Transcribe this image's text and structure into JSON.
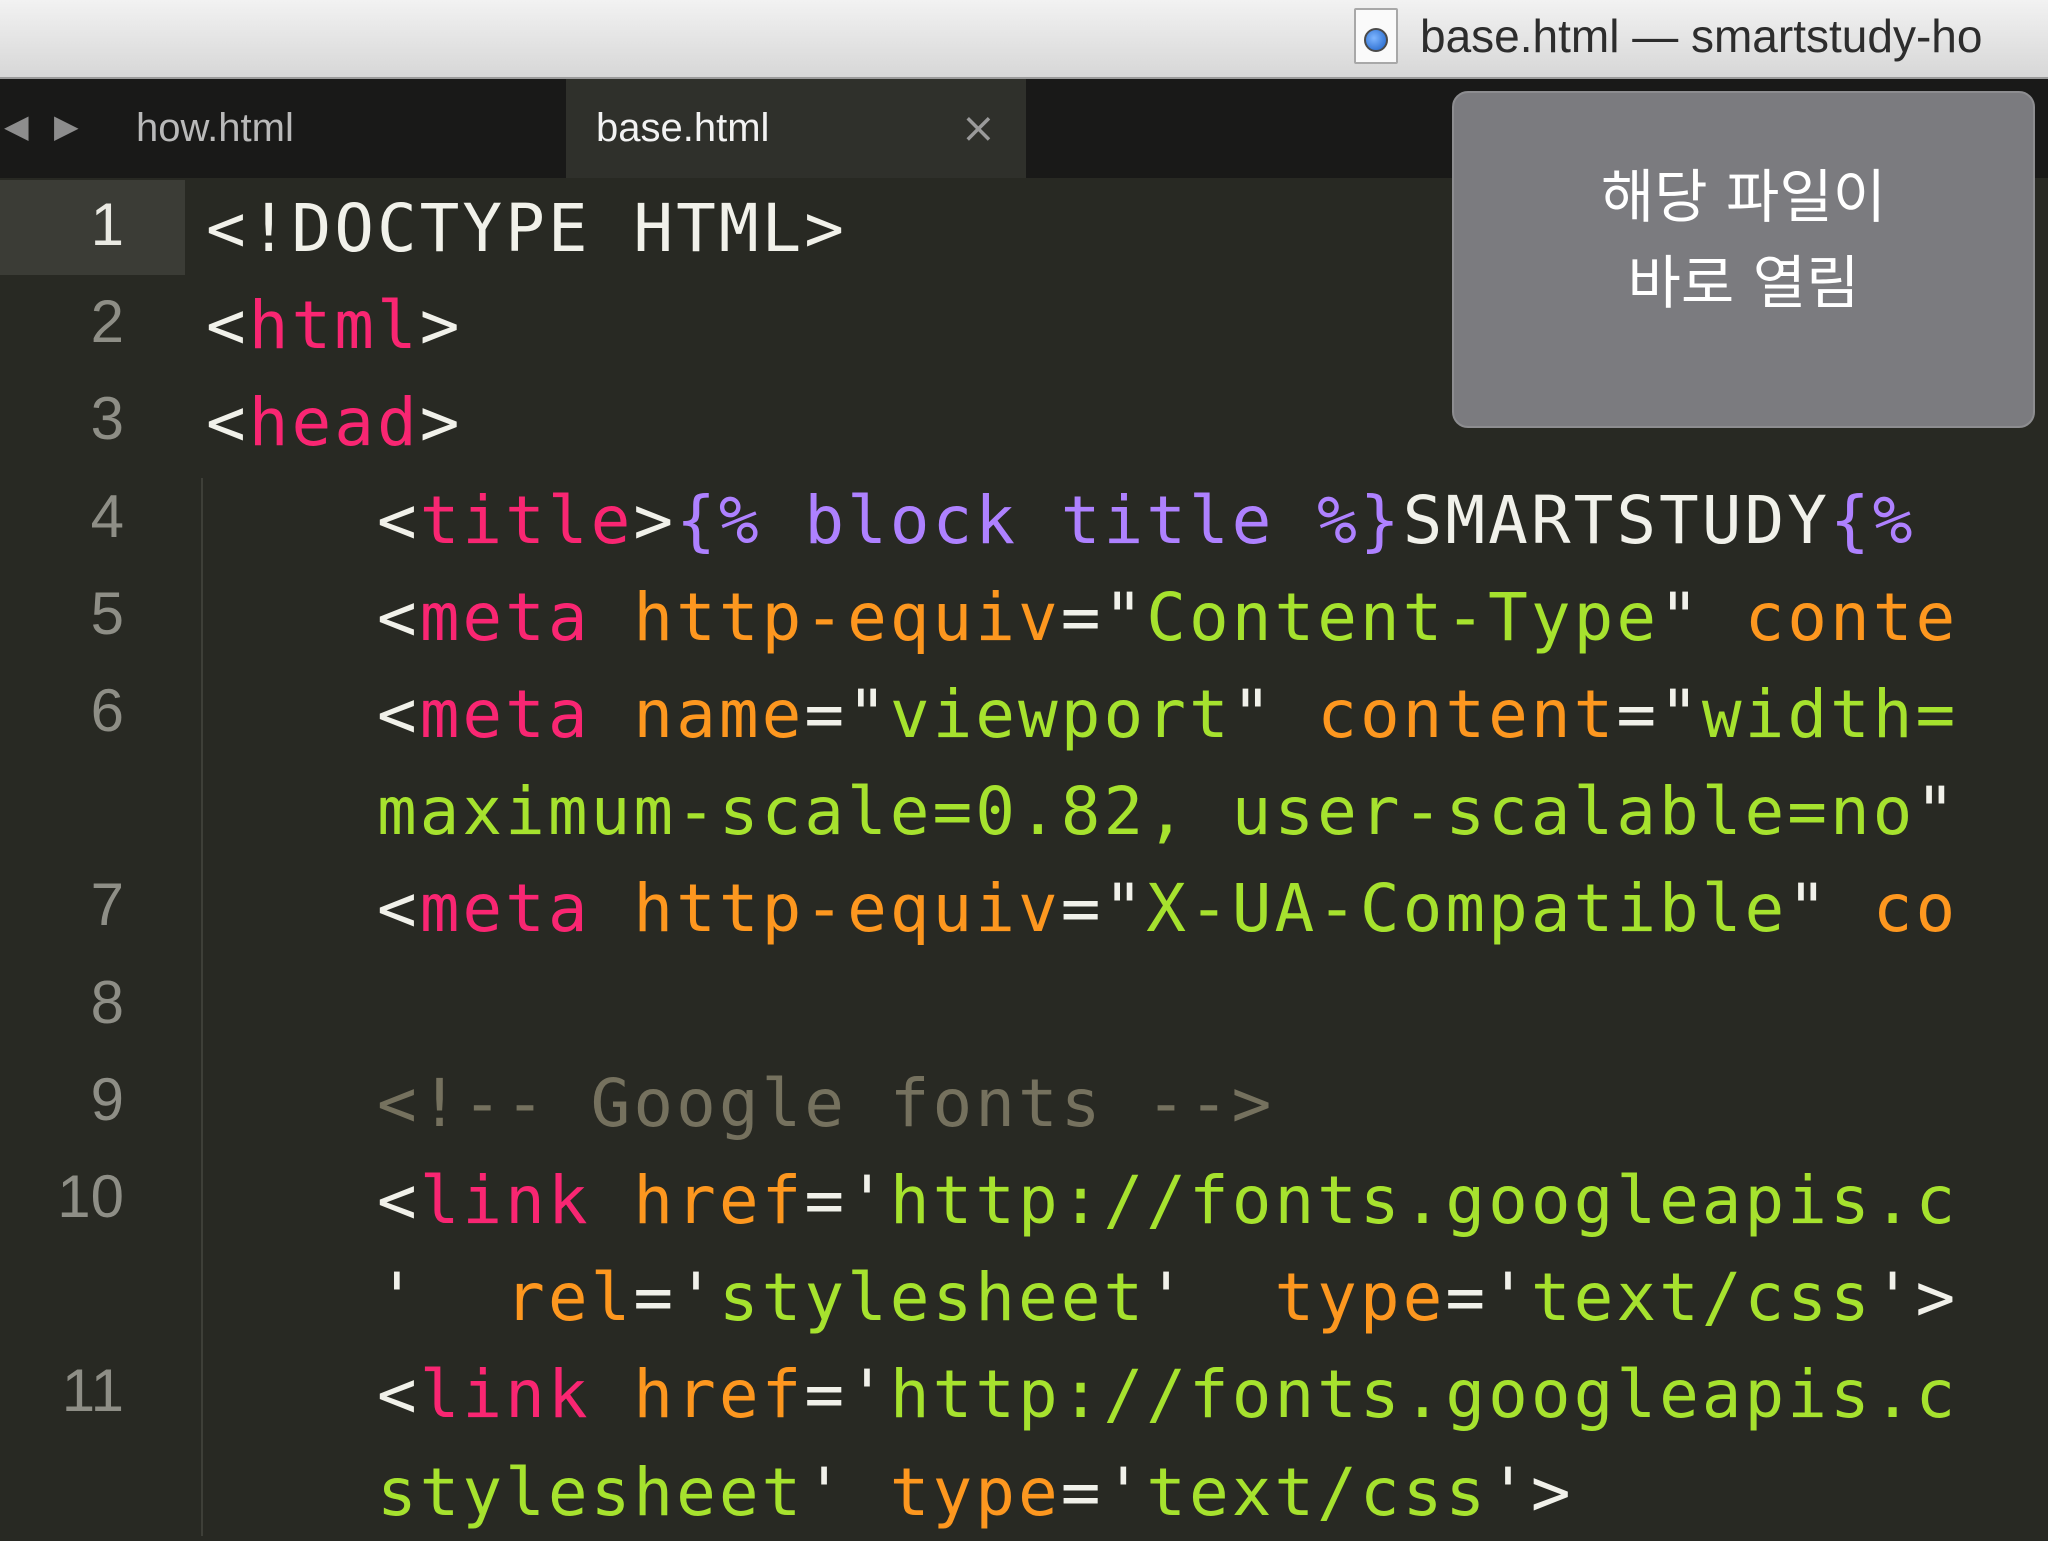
{
  "window": {
    "title": "base.html — smartstudy-ho",
    "file_icon": "html-document-icon"
  },
  "tabs": {
    "nav_back": "◀",
    "nav_forward": "▶",
    "items": [
      {
        "label": "how.html",
        "active": false
      },
      {
        "label": "base.html",
        "active": true,
        "close": "×"
      }
    ]
  },
  "editor": {
    "theme_colors": {
      "background": "#282923",
      "tag": "#f92672",
      "attribute": "#fd971f",
      "string": "#a6e22e",
      "template": "#ae81ff",
      "comment": "#75715e",
      "plain": "#f1f1ea"
    },
    "line_numbers": [
      "1",
      "2",
      "3",
      "4",
      "5",
      "6",
      "7",
      "8",
      "9",
      "10",
      "11"
    ],
    "active_line": "1",
    "lines": [
      [
        {
          "t": "plain",
          "v": "<!DOCTYPE HTML>"
        }
      ],
      [
        {
          "t": "plain",
          "v": "<"
        },
        {
          "t": "tag",
          "v": "html"
        },
        {
          "t": "plain",
          "v": ">"
        }
      ],
      [
        {
          "t": "plain",
          "v": "<"
        },
        {
          "t": "tag",
          "v": "head"
        },
        {
          "t": "plain",
          "v": ">"
        }
      ],
      [
        {
          "t": "plain",
          "v": "    <"
        },
        {
          "t": "tag",
          "v": "title"
        },
        {
          "t": "plain",
          "v": ">"
        },
        {
          "t": "tpl",
          "v": "{% block title %}"
        },
        {
          "t": "plain",
          "v": "SMARTSTUDY"
        },
        {
          "t": "tpl",
          "v": "{%"
        }
      ],
      [
        {
          "t": "plain",
          "v": "    <"
        },
        {
          "t": "tag",
          "v": "meta"
        },
        {
          "t": "plain",
          "v": " "
        },
        {
          "t": "attr",
          "v": "http-equiv"
        },
        {
          "t": "plain",
          "v": "="
        },
        {
          "t": "plain",
          "v": "\""
        },
        {
          "t": "str",
          "v": "Content-Type"
        },
        {
          "t": "plain",
          "v": "\" "
        },
        {
          "t": "attr",
          "v": "conte"
        }
      ],
      [
        {
          "t": "plain",
          "v": "    <"
        },
        {
          "t": "tag",
          "v": "meta"
        },
        {
          "t": "plain",
          "v": " "
        },
        {
          "t": "attr",
          "v": "name"
        },
        {
          "t": "plain",
          "v": "=\""
        },
        {
          "t": "str",
          "v": "viewport"
        },
        {
          "t": "plain",
          "v": "\" "
        },
        {
          "t": "attr",
          "v": "content"
        },
        {
          "t": "plain",
          "v": "=\""
        },
        {
          "t": "str",
          "v": "width="
        }
      ],
      [
        {
          "t": "str",
          "v": "    maximum-scale=0.82, user-scalable=no"
        },
        {
          "t": "plain",
          "v": "\""
        }
      ],
      [
        {
          "t": "plain",
          "v": "    <"
        },
        {
          "t": "tag",
          "v": "meta"
        },
        {
          "t": "plain",
          "v": " "
        },
        {
          "t": "attr",
          "v": "http-equiv"
        },
        {
          "t": "plain",
          "v": "=\""
        },
        {
          "t": "str",
          "v": "X-UA-Compatible"
        },
        {
          "t": "plain",
          "v": "\" "
        },
        {
          "t": "attr",
          "v": "co"
        }
      ],
      [
        {
          "t": "plain",
          "v": ""
        }
      ],
      [
        {
          "t": "cmt",
          "v": "    <!-- Google fonts -->"
        }
      ],
      [
        {
          "t": "plain",
          "v": "    <"
        },
        {
          "t": "tag",
          "v": "link"
        },
        {
          "t": "plain",
          "v": " "
        },
        {
          "t": "attr",
          "v": "href"
        },
        {
          "t": "plain",
          "v": "='"
        },
        {
          "t": "str",
          "v": "http://fonts.googleapis.c"
        }
      ],
      [
        {
          "t": "plain",
          "v": "    '  "
        },
        {
          "t": "attr",
          "v": "rel"
        },
        {
          "t": "plain",
          "v": "='"
        },
        {
          "t": "str",
          "v": "stylesheet"
        },
        {
          "t": "plain",
          "v": "'  "
        },
        {
          "t": "attr",
          "v": "type"
        },
        {
          "t": "plain",
          "v": "='"
        },
        {
          "t": "str",
          "v": "text/css"
        },
        {
          "t": "plain",
          "v": "'>"
        }
      ],
      [
        {
          "t": "plain",
          "v": "    <"
        },
        {
          "t": "tag",
          "v": "link"
        },
        {
          "t": "plain",
          "v": " "
        },
        {
          "t": "attr",
          "v": "href"
        },
        {
          "t": "plain",
          "v": "='"
        },
        {
          "t": "str",
          "v": "http://fonts.googleapis.c"
        }
      ],
      [
        {
          "t": "str",
          "v": "    stylesheet"
        },
        {
          "t": "plain",
          "v": "' "
        },
        {
          "t": "attr",
          "v": "type"
        },
        {
          "t": "plain",
          "v": "='"
        },
        {
          "t": "str",
          "v": "text/css"
        },
        {
          "t": "plain",
          "v": "'>"
        }
      ]
    ]
  },
  "tooltip": {
    "line1": "해당 파일이",
    "line2": "바로 열림"
  }
}
